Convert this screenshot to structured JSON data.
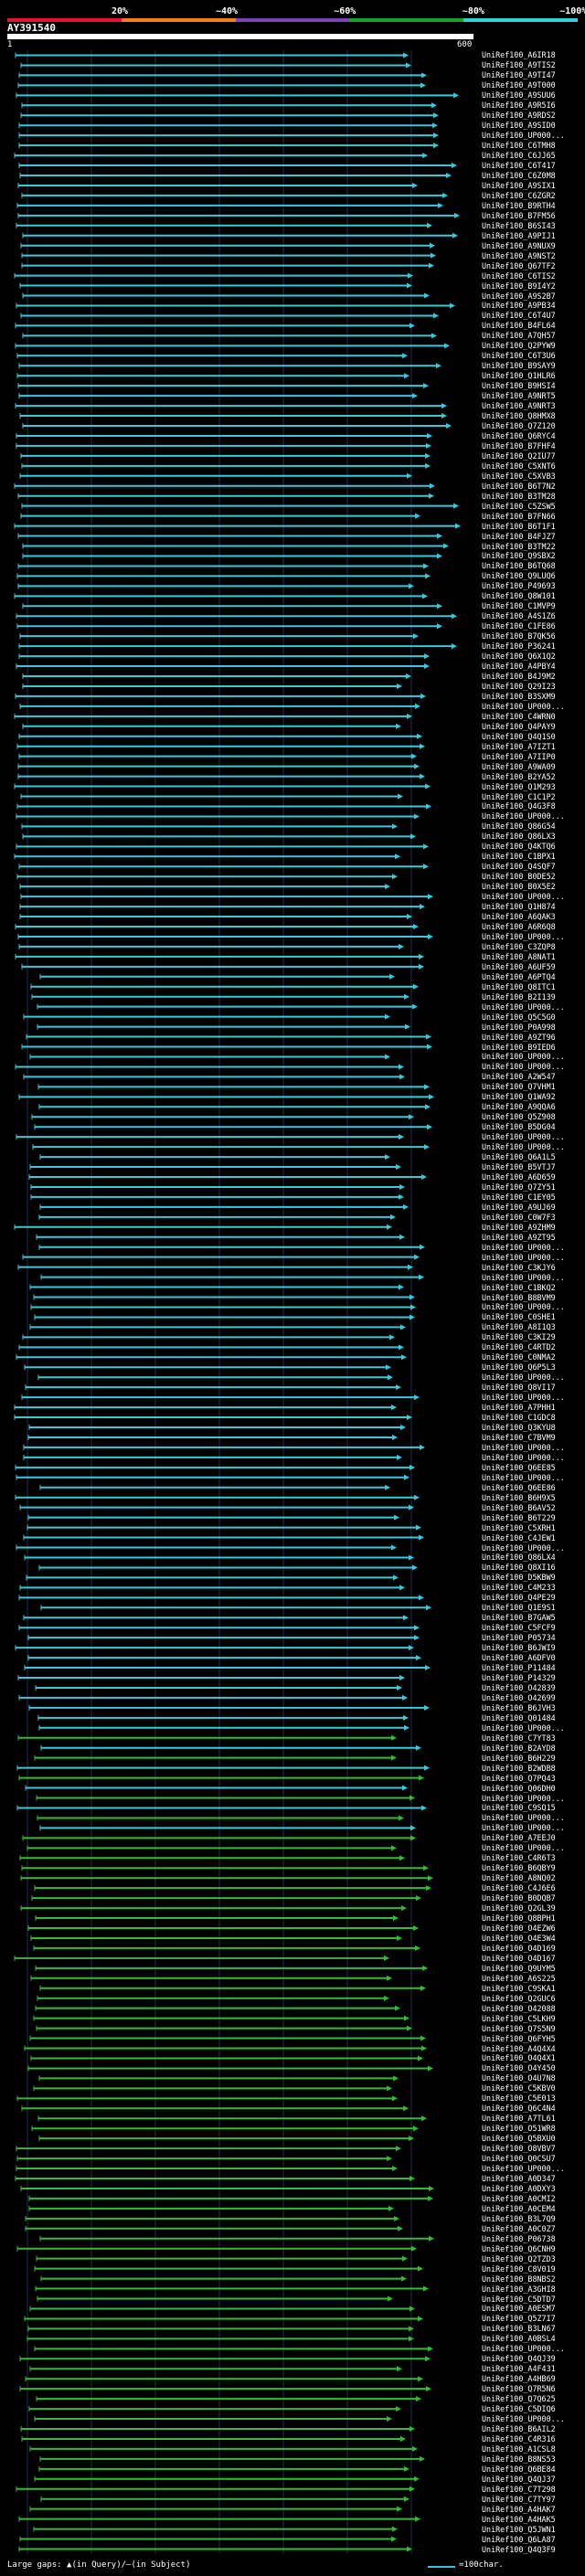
{
  "scale": {
    "labels": [
      "20%",
      "~40%",
      "~60%",
      "~80%",
      "~100%"
    ],
    "colors": [
      "#e8102a",
      "#f08018",
      "#8040c0",
      "#20a020",
      "#30d0e0"
    ]
  },
  "query": {
    "id": "AY391540",
    "start_tick": "1",
    "end_tick": "600"
  },
  "colors": {
    "high_identity": "#3cc8d8",
    "mid_identity": "#38b838",
    "background": "#000000",
    "grid": "#203050"
  },
  "hits": [
    "UniRef100_A6IR18",
    "UniRef100_A9TIS2",
    "UniRef100_A9TI47",
    "UniRef100_A9T000",
    "UniRef100_A9SUU6",
    "UniRef100_A9R5I6",
    "UniRef100_A9RDS2",
    "UniRef100_A9SID0",
    "UniRef100_UP000...",
    "UniRef100_C6TMH8",
    "UniRef100_C6JJ65",
    "UniRef100_C6T417",
    "UniRef100_C6Z0M8",
    "UniRef100_A9SIX1",
    "UniRef100_C6ZGR2",
    "UniRef100_B9RTH4",
    "UniRef100_B7FM56",
    "UniRef100_B6SI43",
    "UniRef100_A9PIJ1",
    "UniRef100_A9NUX9",
    "UniRef100_A9NST2",
    "UniRef100_Q67TF2",
    "UniRef100_C6TIS2",
    "UniRef100_B9I4Y2",
    "UniRef100_A9S2B7",
    "UniRef100_A9PB34",
    "UniRef100_C6T4U7",
    "UniRef100_B4FL64",
    "UniRef100_A7QH57",
    "UniRef100_Q2PYW9",
    "UniRef100_C6T3U6",
    "UniRef100_B9SAY9",
    "UniRef100_Q1HLR6",
    "UniRef100_B9HSI4",
    "UniRef100_A9NRT5",
    "UniRef100_A9NRT3",
    "UniRef100_Q8HMX8",
    "UniRef100_Q7Z120",
    "UniRef100_Q6RYC4",
    "UniRef100_B7FHF4",
    "UniRef100_Q2IU77",
    "UniRef100_C5XNT6",
    "UniRef100_C5XVB3",
    "UniRef100_B6T7N2",
    "UniRef100_B3TM28",
    "UniRef100_C5ZSW5",
    "UniRef100_B7FN66",
    "UniRef100_B6T1F1",
    "UniRef100_B4FJZ7",
    "UniRef100_B3TM22",
    "UniRef100_Q9SBX2",
    "UniRef100_B6TQ68",
    "UniRef100_Q9LUQ6",
    "UniRef100_P49693",
    "UniRef100_Q8W101",
    "UniRef100_C1MVP9",
    "UniRef100_A4S1Z6",
    "UniRef100_C1FE86",
    "UniRef100_B7QK56",
    "UniRef100_P36241",
    "UniRef100_Q6X1Q2",
    "UniRef100_A4PBY4",
    "UniRef100_B4J9M2",
    "UniRef100_Q29I23",
    "UniRef100_B3SXM9",
    "UniRef100_UP000...",
    "UniRef100_C4WRN0",
    "UniRef100_Q4PAY9",
    "UniRef100_Q4Q1S0",
    "UniRef100_A7IZT1",
    "UniRef100_A7IIP0",
    "UniRef100_A9WA09",
    "UniRef100_B2YA52",
    "UniRef100_Q1M293",
    "UniRef100_C1C1P2",
    "UniRef100_Q4G3F8",
    "UniRef100_UP000...",
    "UniRef100_Q86G54",
    "UniRef100_Q86LX3",
    "UniRef100_Q4KTQ6",
    "UniRef100_C1BPX1",
    "UniRef100_Q4SQF7",
    "UniRef100_B0DE52",
    "UniRef100_B0X5E2",
    "UniRef100_UP000...",
    "UniRef100_Q1H874",
    "UniRef100_A6QAK3",
    "UniRef100_A6R6Q8",
    "UniRef100_UP000...",
    "UniRef100_C3ZQP8",
    "UniRef100_A8NAT1",
    "UniRef100_A6UF59",
    "UniRef100_A6PTQ4",
    "UniRef100_Q8ITC1",
    "UniRef100_B2I139",
    "UniRef100_UP000...",
    "UniRef100_Q5C5G0",
    "UniRef100_P0A998",
    "UniRef100_A9ZT96",
    "UniRef100_B9IED6",
    "UniRef100_UP000...",
    "UniRef100_UP000...",
    "UniRef100_A2W547",
    "UniRef100_Q7VHM1",
    "UniRef100_Q1WA92",
    "UniRef100_A9QQA6",
    "UniRef100_Q5Z908",
    "UniRef100_B5DG04",
    "UniRef100_UP000...",
    "UniRef100_UP000...",
    "UniRef100_Q6A1L5",
    "UniRef100_B5VTJ7",
    "UniRef100_A6D659",
    "UniRef100_Q7ZY51",
    "UniRef100_C1EY05",
    "UniRef100_A9UJ69",
    "UniRef100_C0W7F3",
    "UniRef100_A9ZHM9",
    "UniRef100_A9ZT95",
    "UniRef100_UP000...",
    "UniRef100_UP000...",
    "UniRef100_C3KJY6",
    "UniRef100_UP000...",
    "UniRef100_C1BKQ2",
    "UniRef100_B8BVM9",
    "UniRef100_UP000...",
    "UniRef100_C0SHE1",
    "UniRef100_A8I1Q3",
    "UniRef100_C3KI29",
    "UniRef100_C4RTD2",
    "UniRef100_C0NMA2",
    "UniRef100_Q6P5L3",
    "UniRef100_UP000...",
    "UniRef100_Q8VI17",
    "UniRef100_UP000...",
    "UniRef100_A7PHH1",
    "UniRef100_C1GDC8",
    "UniRef100_Q3KYU8",
    "UniRef100_C7BVM9",
    "UniRef100_UP000...",
    "UniRef100_UP000...",
    "UniRef100_Q6EE85",
    "UniRef100_UP000...",
    "UniRef100_Q6EE86",
    "UniRef100_B6H9X5",
    "UniRef100_B6AV52",
    "UniRef100_B6T229",
    "UniRef100_C5XRH1",
    "UniRef100_C4JEW1",
    "UniRef100_UP000...",
    "UniRef100_Q86LX4",
    "UniRef100_Q8XI16",
    "UniRef100_D5KBW9",
    "UniRef100_C4M233",
    "UniRef100_Q4PE29",
    "UniRef100_Q1E9S1",
    "UniRef100_B7GAW5",
    "UniRef100_C5FCF9",
    "UniRef100_P05734",
    "UniRef100_B6JWI9",
    "UniRef100_A6DFV0",
    "UniRef100_P11484",
    "UniRef100_P14329",
    "UniRef100_O42839",
    "UniRef100_O42699",
    "UniRef100_B6JVH3",
    "UniRef100_Q01484",
    "UniRef100_UP000...",
    "UniRef100_C7YT83",
    "UniRef100_B2AYD8",
    "UniRef100_B6H229",
    "UniRef100_B2WDB8",
    "UniRef100_Q7PQ43",
    "UniRef100_Q06DH0",
    "UniRef100_UP000...",
    "UniRef100_C9SQ15",
    "UniRef100_UP000...",
    "UniRef100_UP000...",
    "UniRef100_A7EEJ0",
    "UniRef100_UP000...",
    "UniRef100_C4R6T3",
    "UniRef100_B6QBY9",
    "UniRef100_A8NQ02",
    "UniRef100_C4J6E6",
    "UniRef100_B0DQB7",
    "UniRef100_Q2GL39",
    "UniRef100_Q8BPH1",
    "UniRef100_O4EZW6",
    "UniRef100_O4E3W4",
    "UniRef100_O4D169",
    "UniRef100_O4D167",
    "UniRef100_Q9UYM5",
    "UniRef100_A6S225",
    "UniRef100_C9SKA1",
    "UniRef100_Q2GUC6",
    "UniRef100_O42088",
    "UniRef100_C5LKH9",
    "UniRef100_Q7S5N9",
    "UniRef100_Q6FYH5",
    "UniRef100_A4Q4X4",
    "UniRef100_O4Q4X1",
    "UniRef100_O4Y450",
    "UniRef100_O4U7N8",
    "UniRef100_C5KBV0",
    "UniRef100_C5E013",
    "UniRef100_Q6C4N4",
    "UniRef100_A7TL61",
    "UniRef100_O51WR8",
    "UniRef100_Q5BXU0",
    "UniRef100_O8VBV7",
    "UniRef100_Q0CSU7",
    "UniRef100_UP000...",
    "UniRef100_A0D347",
    "UniRef100_A0DXY3",
    "UniRef100_A0CMI2",
    "UniRef100_A0CEM4",
    "UniRef100_B3L7Q9",
    "UniRef100_A0C0Z7",
    "UniRef100_P06738",
    "UniRef100_Q6CNH9",
    "UniRef100_Q2TZD3",
    "UniRef100_C8V019",
    "UniRef100_B8NBS2",
    "UniRef100_A3GHI8",
    "UniRef100_C5DTD7",
    "UniRef100_A0ESM7",
    "UniRef100_Q5Z7I7",
    "UniRef100_B3LN67",
    "UniRef100_A0BSL4",
    "UniRef100_UP000...",
    "UniRef100_Q4QJ39",
    "UniRef100_A4F431",
    "UniRef100_A4HB69",
    "UniRef100_Q7R5N6",
    "UniRef100_Q7Q625",
    "UniRef100_C5DIQ6",
    "UniRef100_UP000...",
    "UniRef100_B6AIL2",
    "UniRef100_C4R316",
    "UniRef100_A1CSL8",
    "UniRef100_B8NS53",
    "UniRef100_Q6BE84",
    "UniRef100_Q4QJ37",
    "UniRef100_C7T298",
    "UniRef100_C7TY97",
    "UniRef100_A4HAK7",
    "UniRef100_A4HAK5",
    "UniRef100_Q5JWN1",
    "UniRef100_Q6LA87",
    "UniRef100_Q4Q3F9"
  ],
  "legend": {
    "gaps_text": "Large gaps: ▲(in Query)/—(in Subject)",
    "scale_text": "=100char."
  }
}
